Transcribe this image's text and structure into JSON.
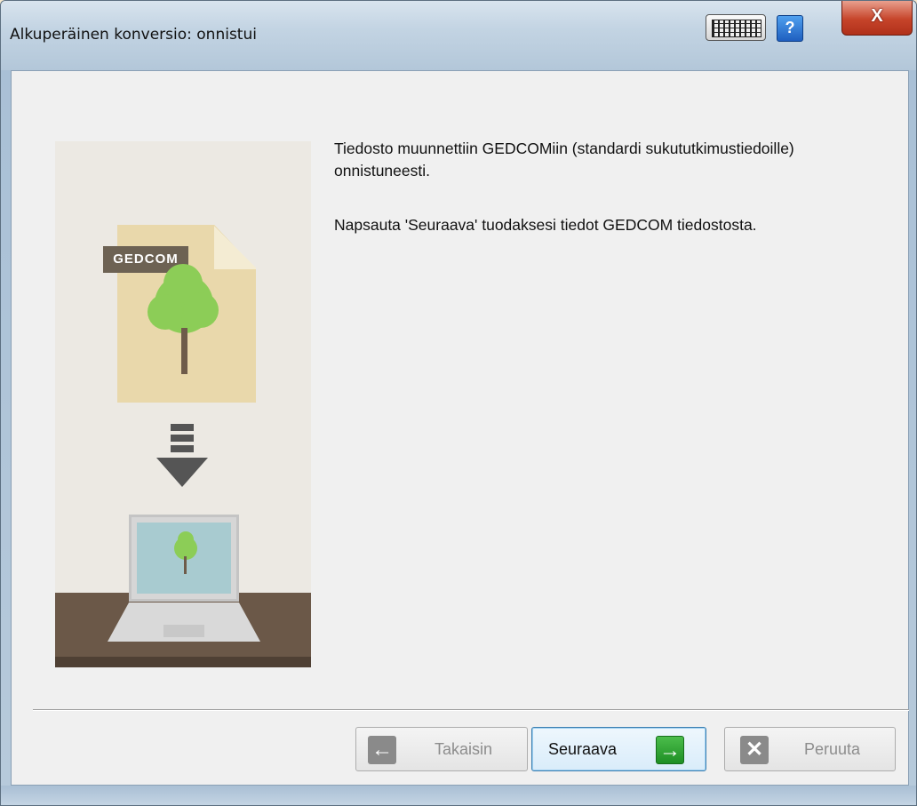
{
  "window": {
    "title": "Alkuperäinen konversio: onnistui",
    "close_label": "X",
    "help_label": "?"
  },
  "illustration": {
    "badge_label": "GEDCOM"
  },
  "content": {
    "line1": "Tiedosto muunnettiin GEDCOMiin (standardi sukututkimustiedoille) onnistuneesti.",
    "line2": "Napsauta 'Seuraava' tuodaksesi tiedot GEDCOM tiedostosta."
  },
  "buttons": {
    "back_label": "Takaisin",
    "next_label": "Seuraava",
    "cancel_label": "Peruuta",
    "back_icon": "←",
    "next_icon": "→",
    "cancel_icon": "✕"
  },
  "colors": {
    "next_icon_bg": "#2a9a2f",
    "disabled_icon_bg": "#8a8a8a",
    "close_button_bg": "#c6442a"
  }
}
